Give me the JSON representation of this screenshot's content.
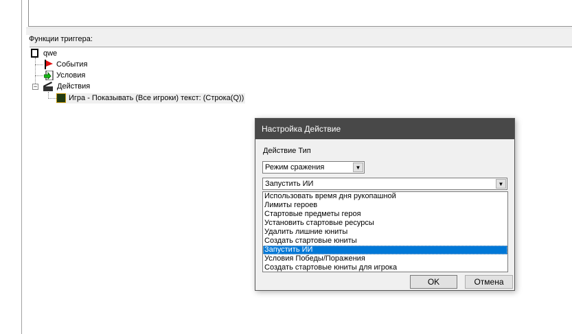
{
  "trigger_functions_label": "Функции триггера:",
  "tree": {
    "root": "qwe",
    "events": "События",
    "conditions": "Условия",
    "actions": "Действия",
    "action_item": "Игра - Показывать (Все игроки) текст: (Строка(Q))"
  },
  "dialog": {
    "title": "Настройка Действие",
    "type_label": "Действие Тип",
    "category_value": "Режим сражения",
    "action_value": "Запустить ИИ",
    "options": [
      "Использовать время дня рукопашной",
      "Лимиты героев",
      "Стартовые предметы героя",
      "Установить стартовые ресурсы",
      "Удалить лишние юниты",
      "Создать стартовые юниты",
      "Запустить ИИ",
      "Условия Победы/Поражения",
      "Создать стартовые юниты для игрока"
    ],
    "selected_index": 6,
    "ok_label": "OK",
    "cancel_label": "Отмена"
  }
}
